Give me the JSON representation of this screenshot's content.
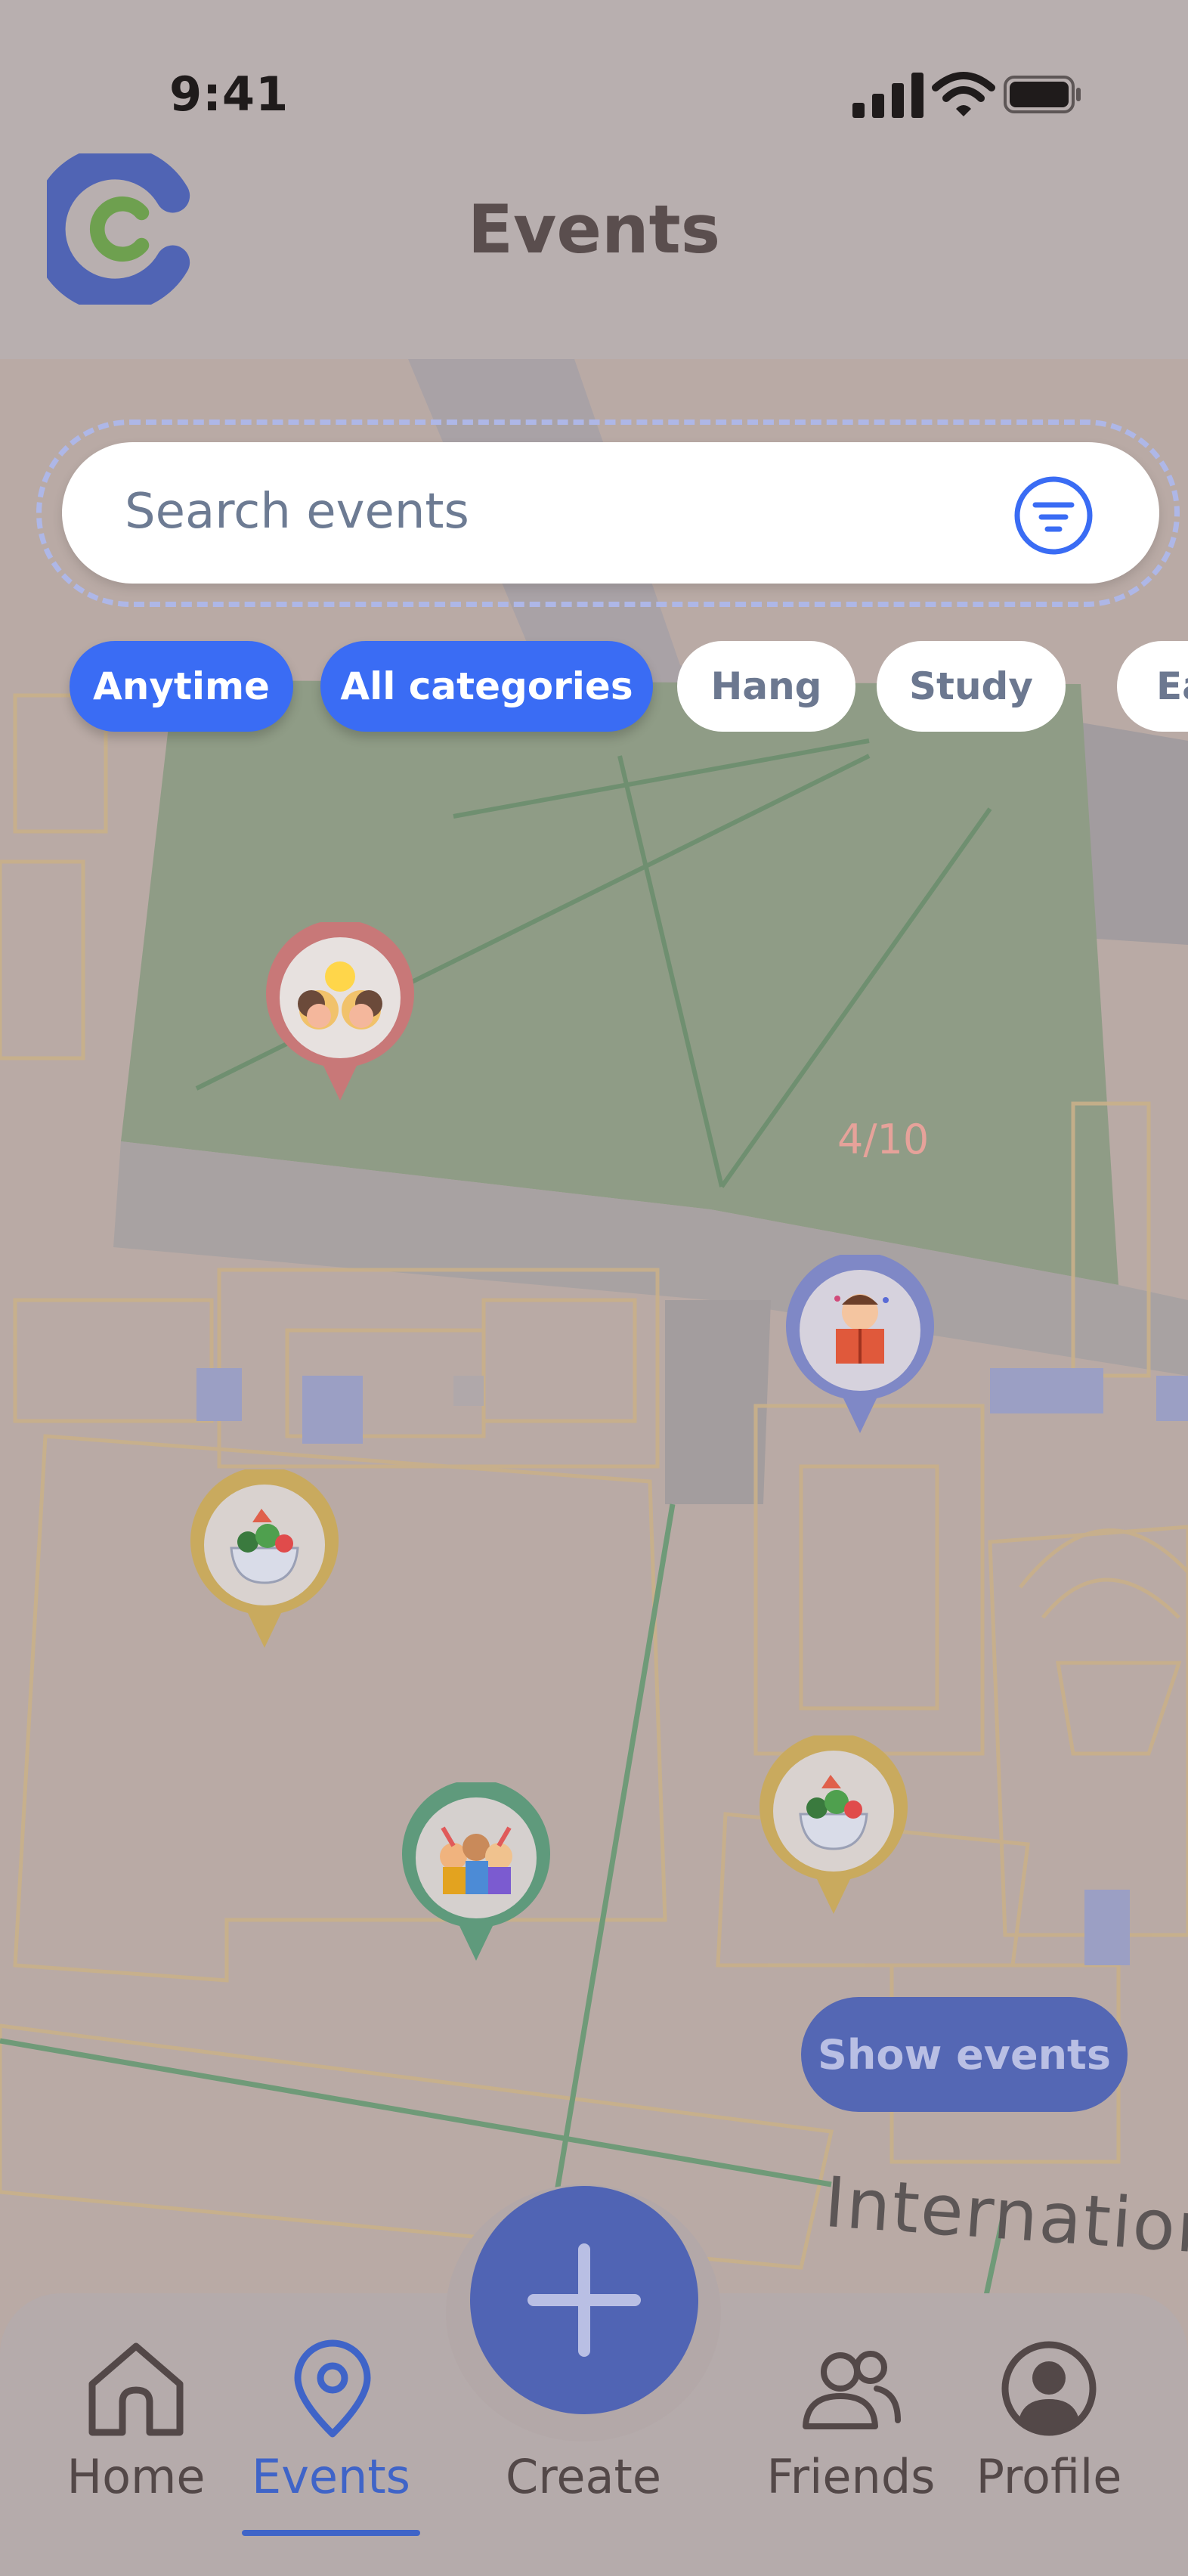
{
  "status_bar": {
    "time": "9:41"
  },
  "header": {
    "title": "Events"
  },
  "search": {
    "placeholder": "Search events"
  },
  "chips": [
    {
      "label": "Anytime",
      "active": true
    },
    {
      "label": "All categories",
      "active": true
    },
    {
      "label": "Hang",
      "active": false
    },
    {
      "label": "Study",
      "active": false
    },
    {
      "label": "Ea",
      "active": false
    }
  ],
  "map": {
    "page_indicator": "4/10",
    "street_label": "International",
    "show_events_label": "Show events",
    "pins": [
      {
        "name": "friends",
        "color": "#c87878"
      },
      {
        "name": "reading",
        "color": "#7f88c6"
      },
      {
        "name": "food",
        "color": "#c9aa5e"
      },
      {
        "name": "party",
        "color": "#5f9a7c"
      },
      {
        "name": "food",
        "color": "#c9aa5e"
      }
    ]
  },
  "nav": {
    "items": [
      {
        "label": "Home",
        "icon": "home-icon"
      },
      {
        "label": "Events",
        "icon": "pin-icon",
        "active": true
      },
      {
        "label": "Create",
        "icon": "plus-icon"
      },
      {
        "label": "Friends",
        "icon": "friends-icon"
      },
      {
        "label": "Profile",
        "icon": "profile-icon"
      }
    ]
  },
  "colors": {
    "accent": "#3a6cf4",
    "brand": "#5064b4",
    "map_green": "#8e9e86"
  }
}
